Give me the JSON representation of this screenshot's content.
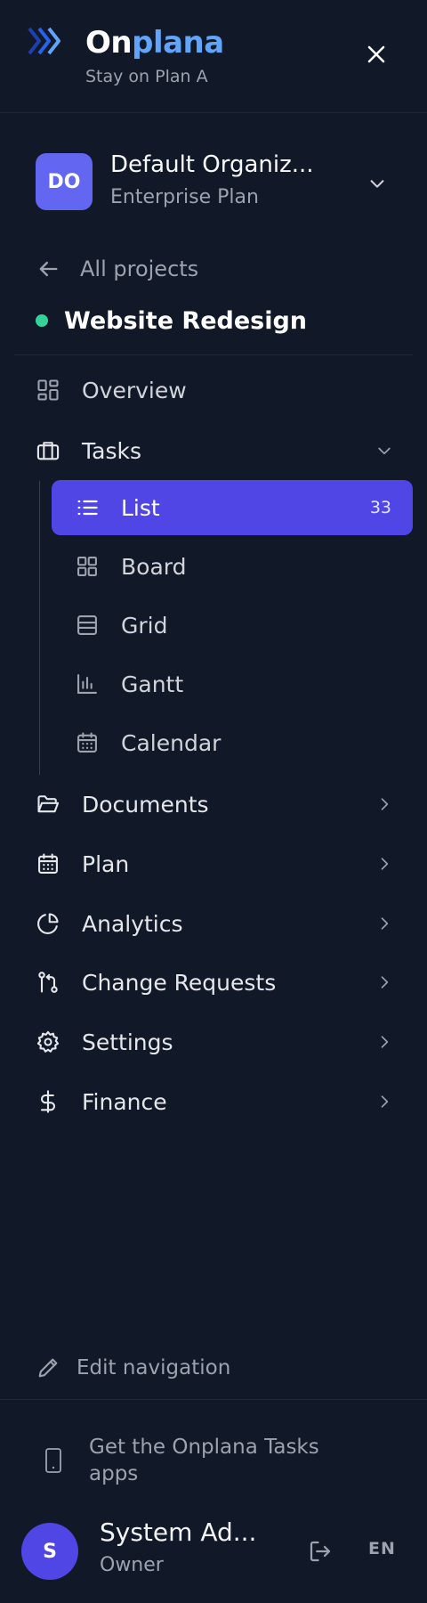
{
  "brand": {
    "name_part1": "On",
    "name_part2": "plana",
    "tagline": "Stay on Plan A"
  },
  "organization": {
    "initials": "DO",
    "name": "Default Organiz...",
    "plan": "Enterprise Plan"
  },
  "back_link": {
    "label": "All projects"
  },
  "project": {
    "name": "Website Redesign",
    "status_color": "#34d399"
  },
  "nav": {
    "overview": "Overview",
    "tasks": "Tasks",
    "tasks_sub": {
      "list": {
        "label": "List",
        "count": "33"
      },
      "board": "Board",
      "grid": "Grid",
      "gantt": "Gantt",
      "calendar": "Calendar"
    },
    "documents": "Documents",
    "plan": "Plan",
    "analytics": "Analytics",
    "change_requests": "Change Requests",
    "settings": "Settings",
    "finance": "Finance"
  },
  "footer": {
    "edit_navigation": "Edit navigation",
    "get_apps": "Get the Onplana Tasks apps",
    "user": {
      "initial": "S",
      "name": "System Ad...",
      "role": "Owner"
    },
    "language": "EN"
  },
  "colors": {
    "background": "#111827",
    "accent": "#5046e5",
    "brand_blue": "#60a5fa"
  }
}
